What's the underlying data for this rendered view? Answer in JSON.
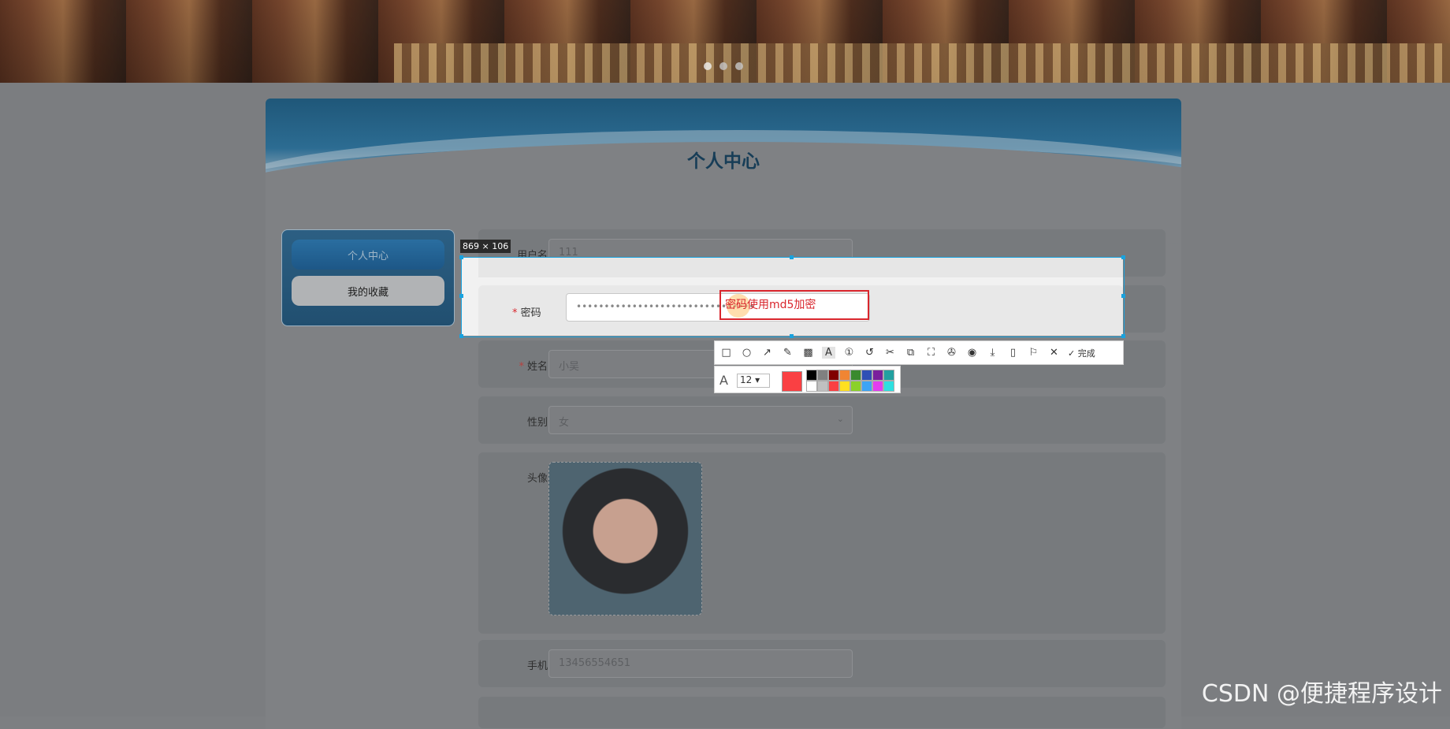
{
  "page_title": "个人中心",
  "sidebar": {
    "items": [
      {
        "label": "个人中心",
        "active": true
      },
      {
        "label": "我的收藏",
        "active": false
      }
    ]
  },
  "form": {
    "username": {
      "label": "用户名",
      "value": "111"
    },
    "password": {
      "label": "密码",
      "value": "••••••••••••••••••••••••••••••••",
      "required": true
    },
    "name": {
      "label": "姓名",
      "value": "小吴",
      "required": true
    },
    "gender": {
      "label": "性别",
      "value": "女"
    },
    "avatar": {
      "label": "头像"
    },
    "phone": {
      "label": "手机",
      "value": "13456554651"
    }
  },
  "screenshot_tool": {
    "size_label": "869 × 106",
    "annotation_text": "密码使用md5加密",
    "font_size": "12",
    "current_color": "#fa4043",
    "done_label": "完成",
    "colors": [
      "#000000",
      "#808080",
      "#800000",
      "#f08533",
      "#3a8a2e",
      "#2f4fb5",
      "#7a1f9c",
      "#22a0a0",
      "#ffffff",
      "#c0c0c0",
      "#fa4043",
      "#ffe020",
      "#8bd12a",
      "#3ca4f5",
      "#e23df0",
      "#2ee0e0"
    ]
  },
  "watermark": "CSDN @便捷程序设计"
}
